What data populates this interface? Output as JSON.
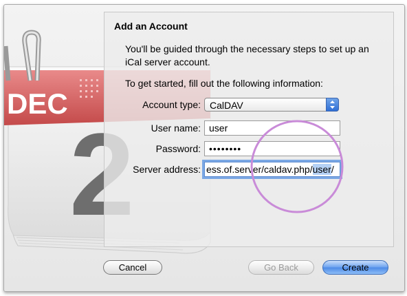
{
  "dialog": {
    "title": "Add an Account",
    "intro": "You'll be guided through the necessary steps to set up an iCal server account.",
    "instruction": "To get started, fill out the following information:"
  },
  "illustration": {
    "month": "DEC",
    "day": "2"
  },
  "form": {
    "account_type": {
      "label": "Account type:",
      "value": "CalDAV"
    },
    "user_name": {
      "label": "User name:",
      "value": "user"
    },
    "password": {
      "label": "Password:",
      "value": "••••••••"
    },
    "server_address": {
      "label": "Server address:",
      "value_prefix": "ess.of.server/caldav.php/",
      "value_selected": "user",
      "value_suffix": "/"
    }
  },
  "buttons": {
    "cancel": "Cancel",
    "go_back": "Go Back",
    "create": "Create"
  },
  "annotation": {
    "color": "#c98bd8"
  }
}
